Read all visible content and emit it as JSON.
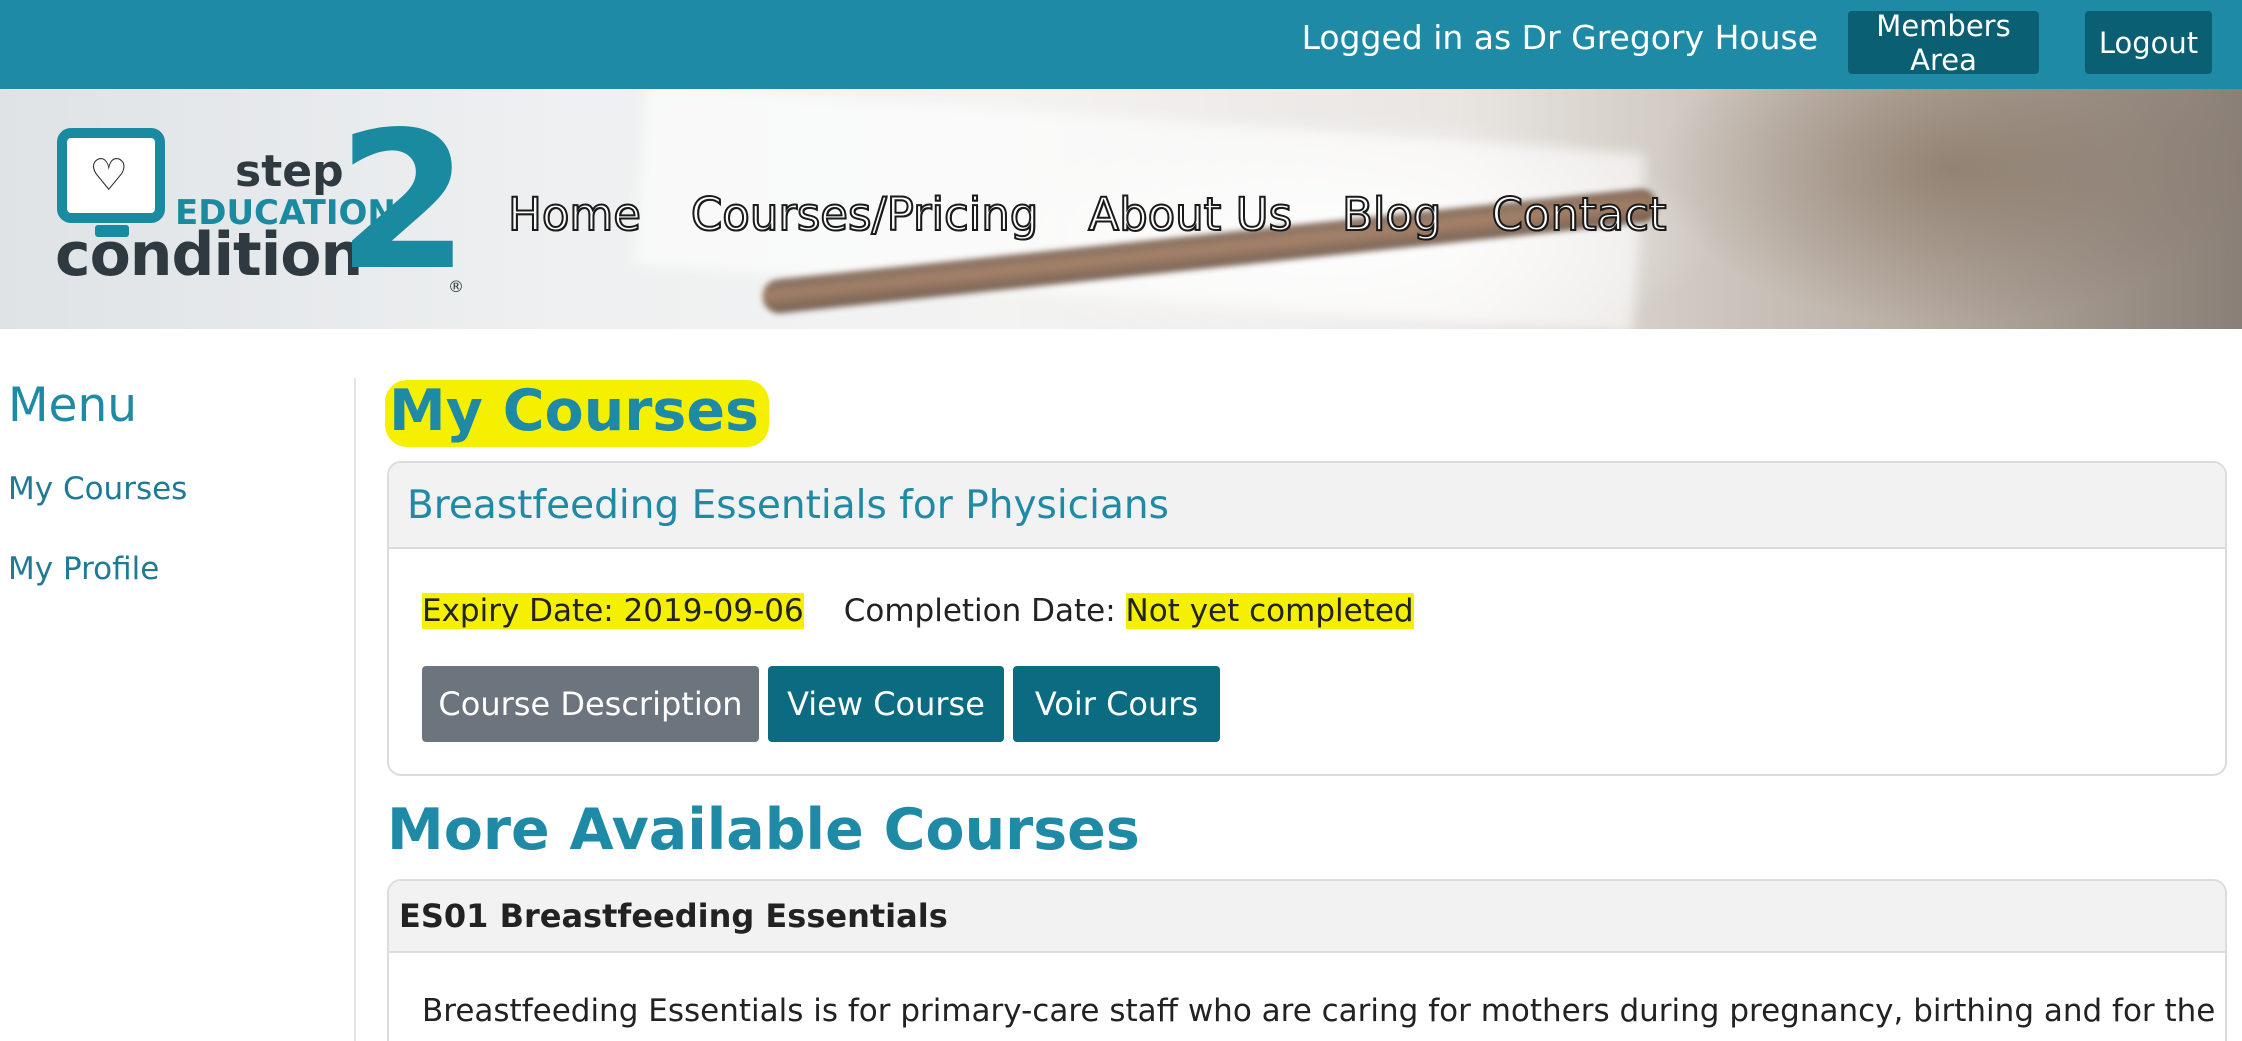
{
  "topbar": {
    "logged_in_text": "Logged in as Dr Gregory House",
    "members_area_label": "Members Area",
    "logout_label": "Logout",
    "bg_color": "#1e8aa6",
    "button_color": "#0b5f73"
  },
  "logo": {
    "step": "step",
    "education": "EDUCATION",
    "condition": "condition",
    "two": "2",
    "registered": "®",
    "icon": "heart-monitor-icon"
  },
  "nav": {
    "items": [
      "Home",
      "Courses/Pricing",
      "About Us",
      "Blog",
      "Contact"
    ]
  },
  "sidebar": {
    "title": "Menu",
    "items": [
      "My Courses",
      "My Profile"
    ]
  },
  "main": {
    "my_courses_heading": "My Courses",
    "enrolled_course": {
      "title": "Breastfeeding Essentials for Physicians",
      "expiry_label": "Expiry Date: 2019-09-06",
      "completion_label": "Completion Date:",
      "completion_value": "Not yet completed",
      "buttons": {
        "description": "Course Description",
        "view": "View Course",
        "voir": "Voir Cours"
      }
    },
    "more_heading": "More Available Courses",
    "available_course": {
      "title": "ES01 Breastfeeding Essentials",
      "description": "Breastfeeding Essentials is for primary-care staff who are caring for mothers during pregnancy, birthing and for the"
    }
  },
  "colors": {
    "accent": "#1e8aa6",
    "highlight": "#f5f000",
    "secondary_button": "#6c757d",
    "primary_button": "#0b6b80"
  }
}
